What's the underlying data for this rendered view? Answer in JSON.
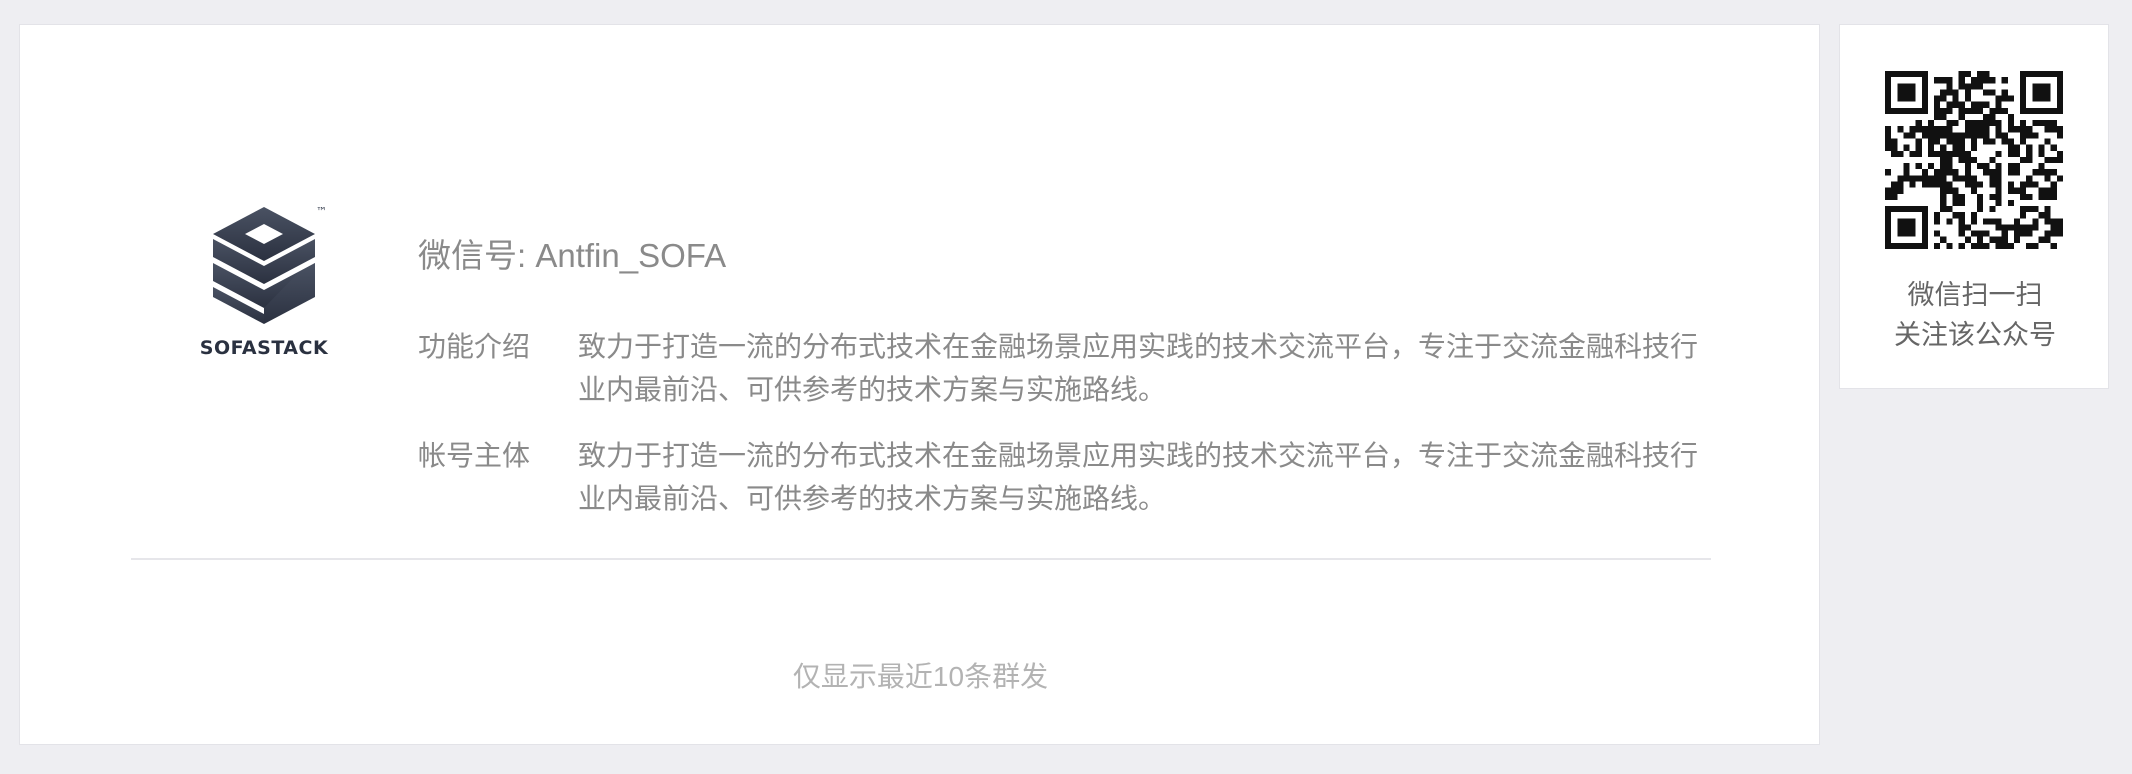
{
  "profile": {
    "logo_name": "SOFASTACK",
    "logo_mark": "™",
    "account_id": "微信号: Antfin_SOFA",
    "intro_label": "功能介绍",
    "intro_text": "致力于打造一流的分布式技术在金融场景应用实践的技术交流平台，专注于交流金融科技行业内最前沿、可供参考的技术方案与实施路线。",
    "owner_label": "帐号主体",
    "owner_text": "致力于打造一流的分布式技术在金融场景应用实践的技术交流平台，专注于交流金融科技行业内最前沿、可供参考的技术方案与实施路线。",
    "footer_note": "仅显示最近10条群发"
  },
  "qr": {
    "icon": "qr-code-icon",
    "caption_line1": "微信扫一扫",
    "caption_line2": "关注该公众号"
  },
  "colors": {
    "page_bg": "#eeeef2",
    "card_bg": "#ffffff",
    "text_muted": "#8a8a8a",
    "logo_dark": "#3a4252"
  }
}
